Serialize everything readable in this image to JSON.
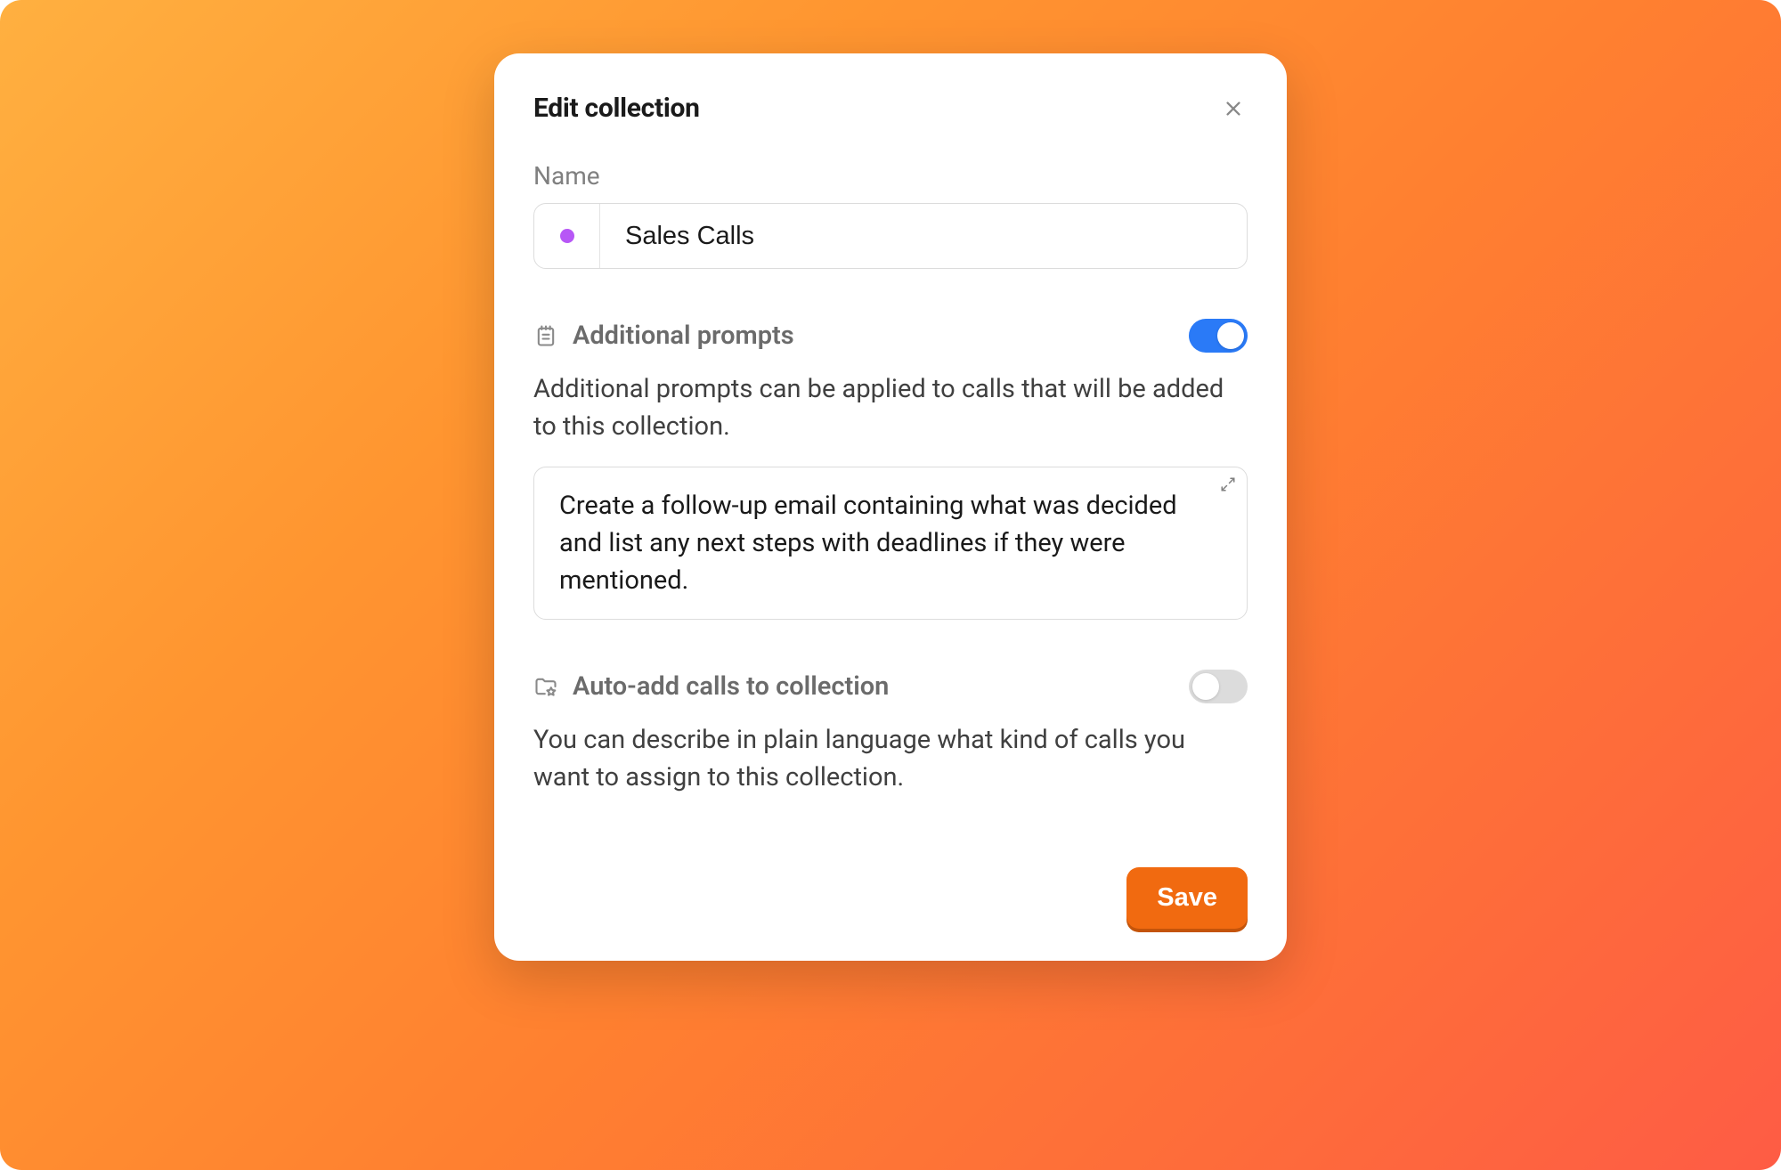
{
  "modal": {
    "title": "Edit collection",
    "name_label": "Name",
    "name_value": "Sales Calls",
    "color_dot": "#B757F6",
    "sections": {
      "additional_prompts": {
        "title": "Additional prompts",
        "enabled": true,
        "description": "Additional prompts can be applied to calls that will be added to this collection.",
        "value": "Create a follow-up email containing what was decided and list any next steps with deadlines if they were mentioned."
      },
      "auto_add": {
        "title": "Auto-add calls to collection",
        "enabled": false,
        "description": "You can describe in plain language what kind of calls you want to assign to this collection."
      }
    },
    "save_label": "Save"
  },
  "colors": {
    "accent_toggle_on": "#2A7AF7",
    "save_button": "#F16A10"
  }
}
